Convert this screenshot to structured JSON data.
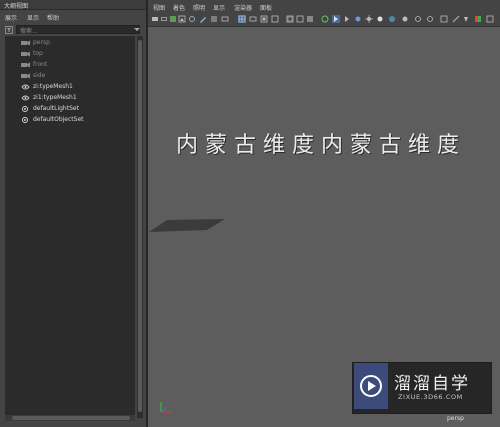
{
  "outliner": {
    "title": "大纲视图",
    "menu": [
      "展示",
      "显示",
      "帮助"
    ],
    "search_placeholder": "搜索...",
    "items": [
      {
        "label": "persp",
        "icon": "camera-icon",
        "dim": true
      },
      {
        "label": "top",
        "icon": "camera-icon",
        "dim": true
      },
      {
        "label": "front",
        "icon": "camera-icon",
        "dim": true
      },
      {
        "label": "side",
        "icon": "camera-icon",
        "dim": true
      },
      {
        "label": "zi:typeMesh1",
        "icon": "mesh-icon",
        "dim": false
      },
      {
        "label": "zi1:typeMesh1",
        "icon": "mesh-icon",
        "dim": false
      },
      {
        "label": "defaultLightSet",
        "icon": "set-icon",
        "dim": false
      },
      {
        "label": "defaultObjectSet",
        "icon": "set-icon",
        "dim": false
      }
    ]
  },
  "viewport": {
    "menu": [
      "视图",
      "着色",
      "照明",
      "显示",
      "渲染器",
      "面板"
    ],
    "text": "内蒙古维度内蒙古维度",
    "camera_label": "persp"
  },
  "watermark": {
    "title": "溜溜自学",
    "url": "ZIXUE.3D66.COM"
  },
  "colors": {
    "viewport_bg": "#5d5d5d",
    "panel_bg": "#444444",
    "list_bg": "#2b2b2b",
    "axis_x": "#d23c3c",
    "axis_y": "#3cc83c",
    "axis_z": "#4a6ad8"
  }
}
